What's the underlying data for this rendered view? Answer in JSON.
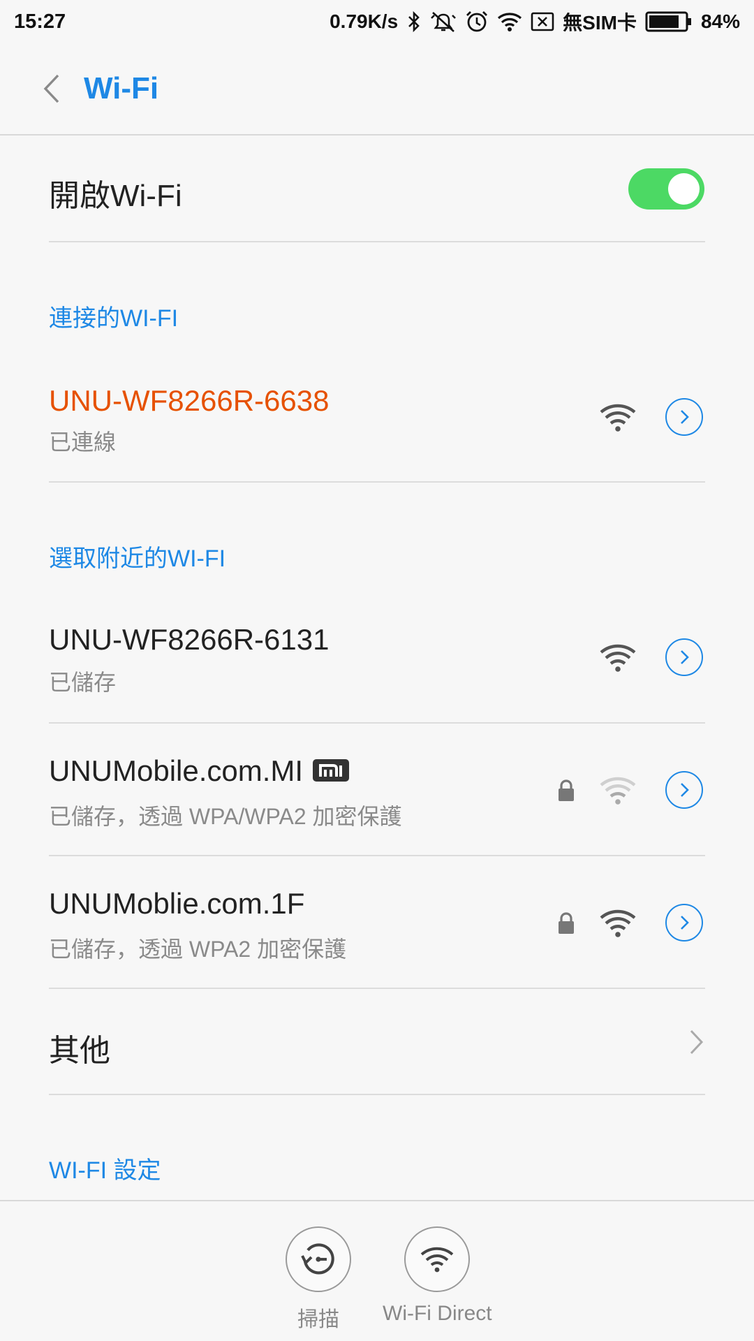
{
  "status_bar": {
    "time": "15:27",
    "net_speed": "0.79K/s",
    "sim": "無SIM卡",
    "battery": "84%",
    "battery_level": 0.84,
    "icons": [
      "bluetooth-icon",
      "mute-icon",
      "alarm-icon",
      "wifi-icon",
      "no-sim-icon",
      "battery-icon"
    ]
  },
  "header": {
    "title": "Wi-Fi"
  },
  "wifi_toggle": {
    "label": "開啟Wi-Fi",
    "on": true
  },
  "connected": {
    "section_label": "連接的WI-FI",
    "network": {
      "name": "UNU-WF8266R-6638",
      "status": "已連線"
    }
  },
  "nearby": {
    "section_label": "選取附近的WI-FI",
    "networks": [
      {
        "name": "UNU-WF8266R-6131",
        "status": "已儲存"
      },
      {
        "name": "UNUMobile.com.MI",
        "status": "已儲存，透過 WPA/WPA2 加密保護"
      },
      {
        "name": "UNUMoblie.com.1F",
        "status": "已儲存，透過 WPA2 加密保護"
      }
    ]
  },
  "other": {
    "label": "其他"
  },
  "settings": {
    "section_label": "WI-FI 設定"
  },
  "bottom_actions": [
    {
      "label": "掃描"
    },
    {
      "label": "Wi-Fi Direct"
    }
  ],
  "colors": {
    "accent": "#1e88e5",
    "connected": "#e65100",
    "toggle_on": "#4cd964"
  }
}
